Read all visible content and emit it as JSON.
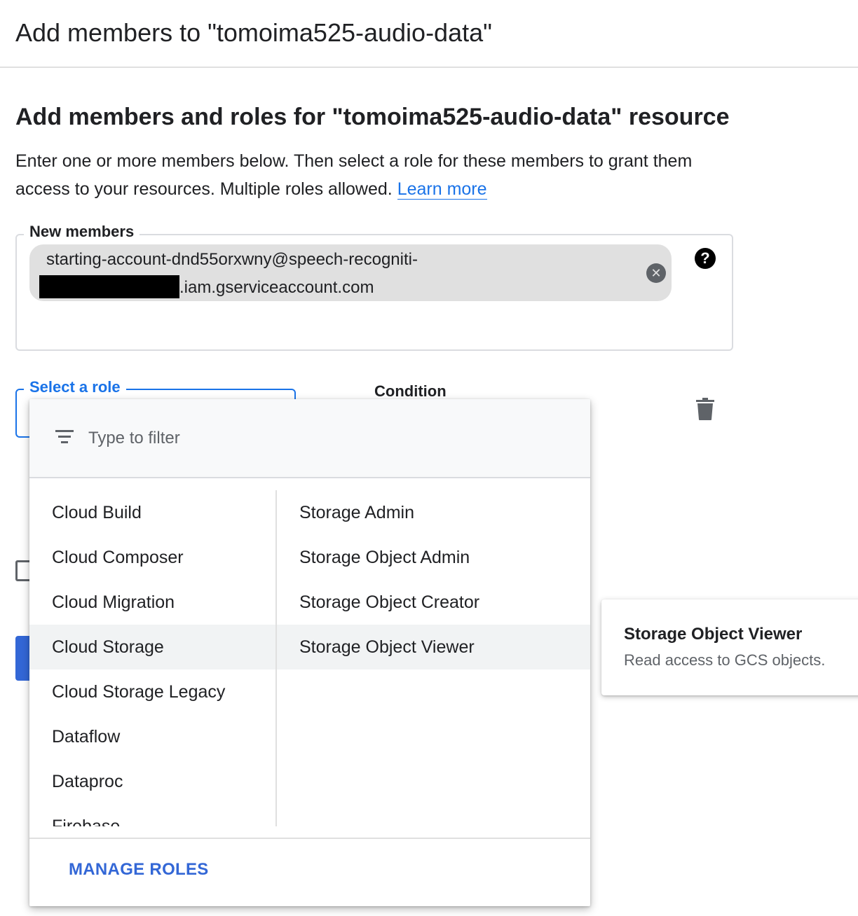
{
  "header": {
    "title": "Add members to \"tomoima525-audio-data\""
  },
  "section": {
    "title": "Add members and roles for \"tomoima525-audio-data\" resource",
    "description": "Enter one or more members below. Then select a role for these members to grant them access to your resources. Multiple roles allowed.",
    "learn_more": "Learn more"
  },
  "members": {
    "label": "New members",
    "chip_line1": "starting-account-dnd55orxwny@speech-recogniti-",
    "chip_line2": ".iam.gserviceaccount.com",
    "close_glyph": "✕",
    "help_glyph": "?"
  },
  "role": {
    "label": "Select a role"
  },
  "condition": {
    "label": "Condition"
  },
  "dropdown": {
    "filter_placeholder": "Type to filter",
    "categories": [
      {
        "label": "Cloud Build"
      },
      {
        "label": "Cloud Composer"
      },
      {
        "label": "Cloud Migration"
      },
      {
        "label": "Cloud Storage"
      },
      {
        "label": "Cloud Storage Legacy"
      },
      {
        "label": "Dataflow"
      },
      {
        "label": "Dataproc"
      },
      {
        "label": "Firebase"
      }
    ],
    "selected_category": "Cloud Storage",
    "roles": [
      {
        "label": "Storage Admin"
      },
      {
        "label": "Storage Object Admin"
      },
      {
        "label": "Storage Object Creator"
      },
      {
        "label": "Storage Object Viewer"
      }
    ],
    "selected_role": "Storage Object Viewer",
    "manage_roles": "MANAGE ROLES"
  },
  "tooltip": {
    "title": "Storage Object Viewer",
    "description": "Read access to GCS objects."
  },
  "colors": {
    "accent": "#1a73e8",
    "selected_row": "#f1f3f4",
    "chip": "#e0e0e0"
  },
  "icons": [
    "help-icon",
    "close-icon",
    "trash-icon",
    "filter-icon"
  ]
}
